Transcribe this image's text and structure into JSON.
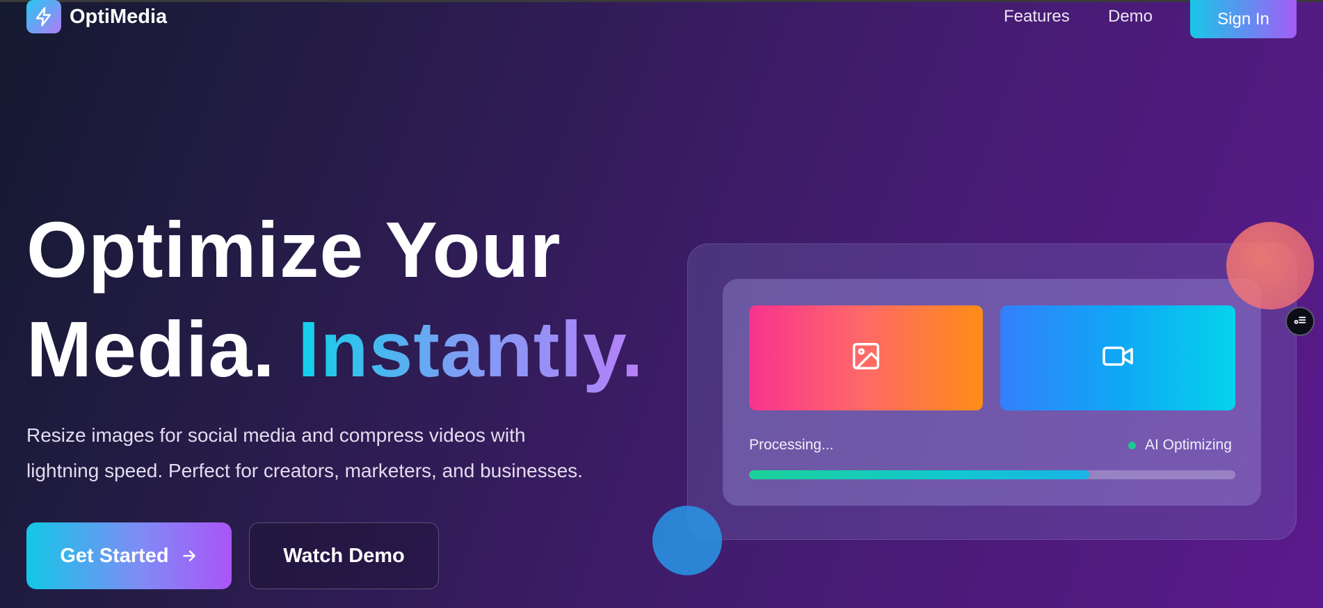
{
  "brand": {
    "name": "OptiMedia",
    "logo_icon": "lightning-icon"
  },
  "nav": {
    "features": "Features",
    "demo": "Demo",
    "sign_in": "Sign In"
  },
  "hero": {
    "headline_line1": "Optimize Your",
    "headline_line2_plain": "Media.",
    "headline_line2_gradient": "Instantly.",
    "subtext_line1": "Resize images for social media and compress videos with",
    "subtext_line2": "lightning speed. Perfect for creators, marketers, and businesses.",
    "primary_button": "Get Started",
    "secondary_button": "Watch Demo"
  },
  "preview": {
    "image_tile_icon": "image-icon",
    "video_tile_icon": "video-camera-icon",
    "processing_label": "Processing...",
    "status_label": "AI Optimizing",
    "progress": 0.7
  },
  "colors": {
    "accent_cyan": "#13c7e6",
    "accent_purple": "#aa55f7",
    "status_green": "#1ec98e"
  }
}
